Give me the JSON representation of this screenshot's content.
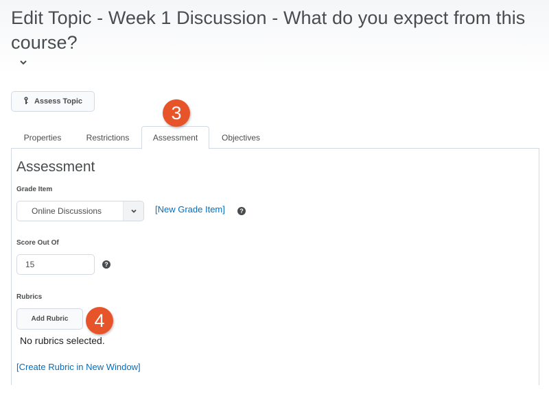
{
  "header": {
    "title": "Edit Topic - Week 1 Discussion - What do you expect from this course?",
    "chevron_icon": "chevron-down-icon"
  },
  "toolbar": {
    "assess_topic_label": "Assess Topic",
    "assess_topic_icon": "key-icon"
  },
  "tabs": [
    {
      "label": "Properties",
      "active": false
    },
    {
      "label": "Restrictions",
      "active": false
    },
    {
      "label": "Assessment",
      "active": true
    },
    {
      "label": "Objectives",
      "active": false
    }
  ],
  "assessment": {
    "section_title": "Assessment",
    "grade_item": {
      "label": "Grade Item",
      "selected_value": "Online Discussions",
      "new_grade_item_link": "[New Grade Item]",
      "help_icon": "question-circle-icon"
    },
    "score_out_of": {
      "label": "Score Out Of",
      "value": "15",
      "help_icon": "question-circle-icon"
    },
    "rubrics": {
      "label": "Rubrics",
      "add_rubric_label": "Add Rubric",
      "status_text": "No rubrics selected.",
      "create_rubric_link": "[Create Rubric in New Window]"
    }
  },
  "annotations": [
    {
      "label": "3",
      "color": "#e8542a"
    },
    {
      "label": "4",
      "color": "#e8542a"
    }
  ],
  "colors": {
    "link": "#006fbf",
    "text": "#494c4e",
    "border": "#d3d9e3",
    "badge": "#e8542a"
  }
}
